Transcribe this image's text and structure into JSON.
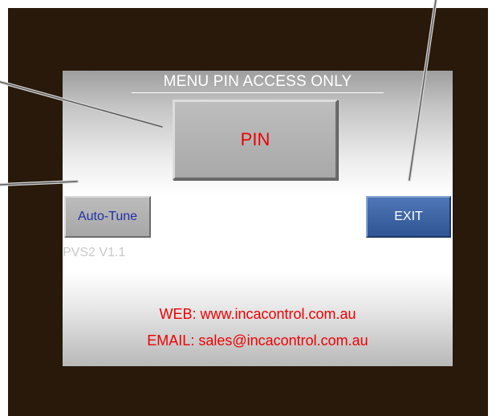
{
  "screen": {
    "title": "MENU PIN ACCESS ONLY",
    "version": "PVS2 V1.1"
  },
  "buttons": {
    "pin_label": "PIN",
    "autotune_label": "Auto-Tune",
    "exit_label": "EXIT"
  },
  "contact": {
    "web": "WEB: www.incacontrol.com.au",
    "email": "EMAIL: sales@incacontrol.com.au"
  },
  "colors": {
    "bezel": "#28190a",
    "alert_text": "#ee0000",
    "exit_button": "#3f66a6",
    "autotune_text": "#1f2fa6"
  }
}
